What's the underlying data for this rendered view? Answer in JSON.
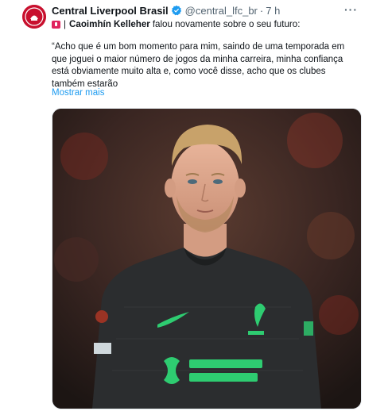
{
  "tweet": {
    "author_name": "Central Liverpool Brasil",
    "handle": "@central_lfc_br",
    "separator": "·",
    "time": "7 h",
    "more_label": "···",
    "line1_sep": "|",
    "line1_bold": "Caoimhín Kelleher",
    "line1_rest": "falou novamente sobre o seu futuro:",
    "quote_lines": [
      "“Acho que é um bom momento para mim, saindo de uma temporada em",
      "que joguei o maior número de jogos da minha carreira, minha confiança",
      "está obviamente muito alta e, como você disse, acho que os clubes",
      "também estarão"
    ],
    "show_more": "Mostrar mais"
  },
  "colors": {
    "accent": "#1d9bf0",
    "avatar_red": "#c8102e",
    "jersey": "#2b2d2f",
    "sponsor_green": "#2ecc71"
  },
  "icons": [
    "verified-badge-icon",
    "red-flag-emoji-icon",
    "more-options-icon"
  ]
}
